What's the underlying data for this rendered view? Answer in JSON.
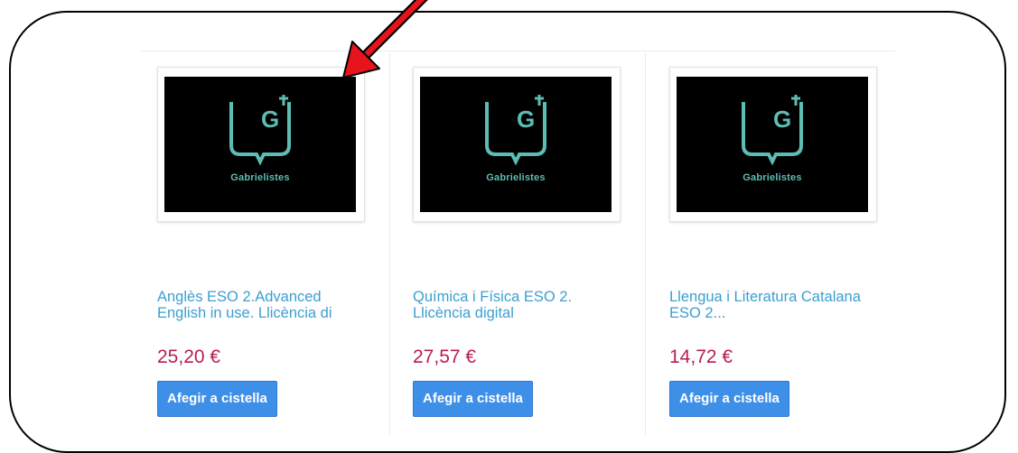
{
  "products": [
    {
      "logo_text": "Gabrielistes",
      "logo_letter": "G",
      "title": "Anglès ESO 2.Advanced English in use. Llicència di",
      "price": "25,20 €",
      "button_label": "Afegir a cistella"
    },
    {
      "logo_text": "Gabrielistes",
      "logo_letter": "G",
      "title": "Química i Física ESO 2. Llicència digital",
      "price": "27,57 €",
      "button_label": "Afegir a cistella"
    },
    {
      "logo_text": "Gabrielistes",
      "logo_letter": "G",
      "title": "Llengua i Literatura Catalana ESO 2...",
      "price": "14,72 €",
      "button_label": "Afegir a cistella"
    }
  ],
  "colors": {
    "link": "#3b9fd1",
    "price": "#b81f4d",
    "button": "#3d8fe8",
    "logo": "#5dbdb3",
    "annotation_arrow": "#e8141b"
  },
  "icons": {
    "logo": "gabrielistes-shield-icon",
    "annotation": "red-arrow-icon"
  }
}
